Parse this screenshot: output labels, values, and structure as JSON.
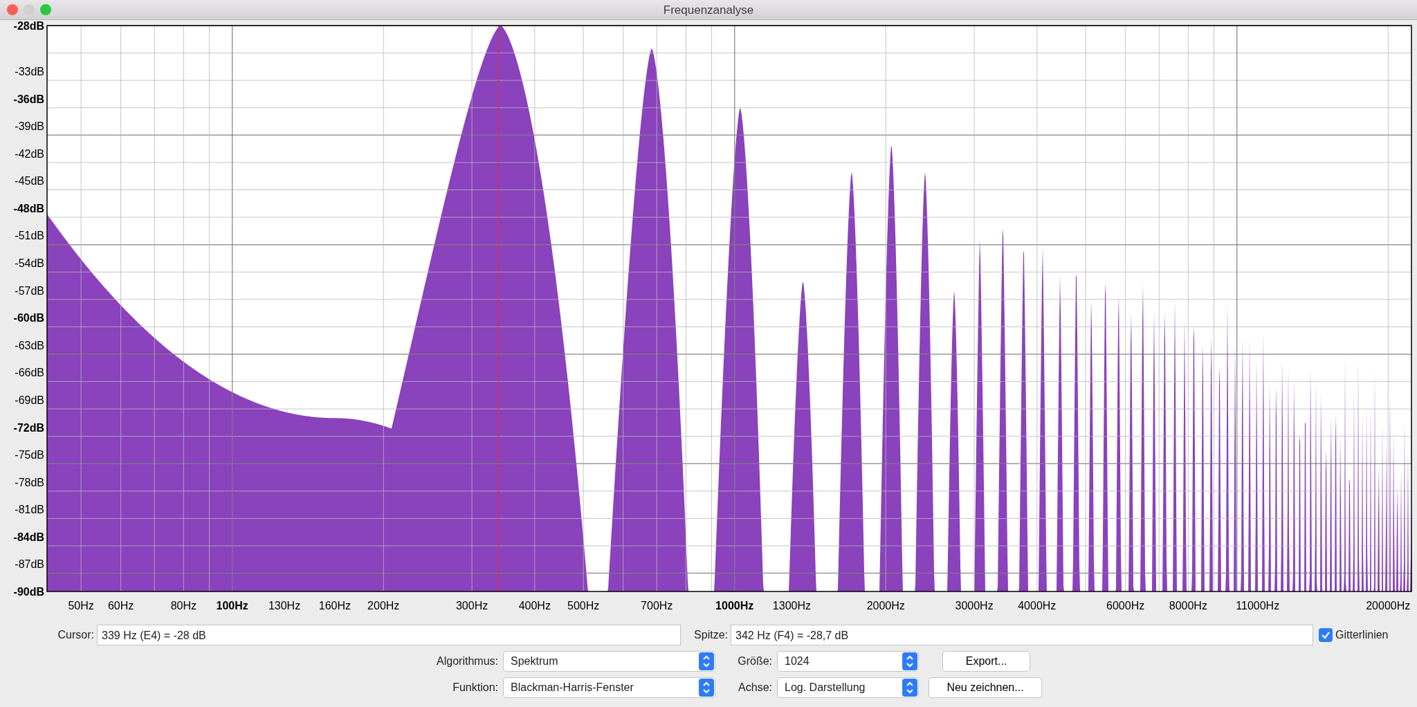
{
  "window": {
    "title": "Frequenzanalyse"
  },
  "plot": {
    "y_axis_labels": [
      {
        "text": "-28dB",
        "major": true
      },
      {
        "text": "-33dB",
        "major": false
      },
      {
        "text": "-36dB",
        "major": true
      },
      {
        "text": "-39dB",
        "major": false
      },
      {
        "text": "-42dB",
        "major": false
      },
      {
        "text": "-45dB",
        "major": false
      },
      {
        "text": "-48dB",
        "major": true
      },
      {
        "text": "-51dB",
        "major": false
      },
      {
        "text": "-54dB",
        "major": false
      },
      {
        "text": "-57dB",
        "major": false
      },
      {
        "text": "-60dB",
        "major": true
      },
      {
        "text": "-63dB",
        "major": false
      },
      {
        "text": "-66dB",
        "major": false
      },
      {
        "text": "-69dB",
        "major": false
      },
      {
        "text": "-72dB",
        "major": true
      },
      {
        "text": "-75dB",
        "major": false
      },
      {
        "text": "-78dB",
        "major": false
      },
      {
        "text": "-81dB",
        "major": false
      },
      {
        "text": "-84dB",
        "major": true
      },
      {
        "text": "-87dB",
        "major": false
      },
      {
        "text": "-90dB",
        "major": true
      }
    ],
    "x_axis_labels": [
      {
        "text": "50Hz",
        "major": false
      },
      {
        "text": "60Hz",
        "major": false
      },
      {
        "text": "80Hz",
        "major": false
      },
      {
        "text": "100Hz",
        "major": true
      },
      {
        "text": "130Hz",
        "major": false
      },
      {
        "text": "160Hz",
        "major": false
      },
      {
        "text": "200Hz",
        "major": false
      },
      {
        "text": "300Hz",
        "major": false
      },
      {
        "text": "400Hz",
        "major": false
      },
      {
        "text": "500Hz",
        "major": false
      },
      {
        "text": "700Hz",
        "major": false
      },
      {
        "text": "1000Hz",
        "major": true
      },
      {
        "text": "1300Hz",
        "major": false
      },
      {
        "text": "2000Hz",
        "major": false
      },
      {
        "text": "3000Hz",
        "major": false
      },
      {
        "text": "4000Hz",
        "major": false
      },
      {
        "text": "6000Hz",
        "major": false
      },
      {
        "text": "8000Hz",
        "major": false
      },
      {
        "text": "11000Hz",
        "major": false
      },
      {
        "text": "20000Hz",
        "major": false
      }
    ]
  },
  "readouts": [
    {
      "label": "Cursor:",
      "value": "339 Hz (E4) = -28 dB"
    },
    {
      "label": "Spitze:",
      "value": "342 Hz (F4) = -28,7 dB"
    }
  ],
  "gridlines": {
    "label": "Gitterlinien",
    "checked": true
  },
  "settings": [
    {
      "label": "Algorithmus:",
      "value": "Spektrum"
    },
    {
      "label": "Größe:",
      "value": "1024"
    },
    {
      "label": "Funktion:",
      "value": "Blackman-Harris-Fenster"
    },
    {
      "label": "Achse:",
      "value": "Log. Darstellung"
    }
  ],
  "buttons": [
    "Export...",
    "Neu zeichnen..."
  ]
}
